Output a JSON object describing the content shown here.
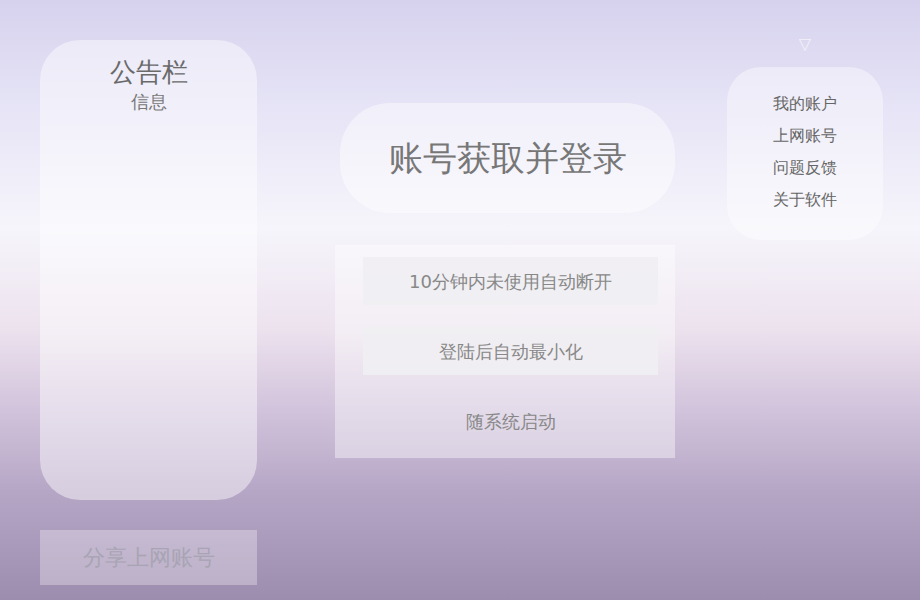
{
  "notice_board": {
    "title": "公告栏",
    "subtitle": "信息"
  },
  "share_button": {
    "label": "分享上网账号"
  },
  "login_button": {
    "label": "账号获取并登录"
  },
  "options": [
    {
      "label": "10分钟内未使用自动断开",
      "checked": true
    },
    {
      "label": "登陆后自动最小化",
      "checked": true
    },
    {
      "label": "随系统启动",
      "checked": false
    }
  ],
  "menu": {
    "toggle": "▽",
    "expanded": true,
    "items": [
      "我的账户",
      "上网账号",
      "问题反馈",
      "关于软件"
    ]
  }
}
